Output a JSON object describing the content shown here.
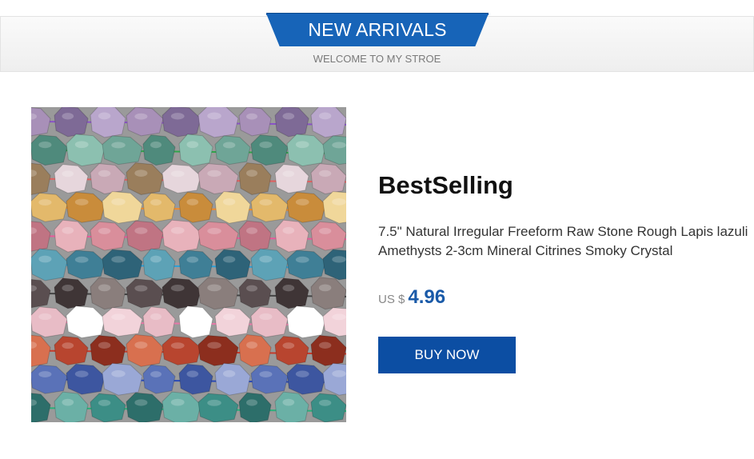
{
  "header": {
    "title": "NEW ARRIVALS",
    "subtitle": "WELCOME TO MY STROE",
    "accent_color": "#1764b8"
  },
  "product": {
    "image_icon": "gemstone-beads-photo",
    "title": "BestSelling",
    "description": "7.5\" Natural Irregular Freeform Raw Stone Rough Lapis lazuli Amethysts 2-3cm Mineral Citrines Smoky Crystal",
    "price_currency": "US $",
    "price_value": "4.96",
    "buy_label": "BUY NOW",
    "button_color": "#0c4ea3"
  }
}
